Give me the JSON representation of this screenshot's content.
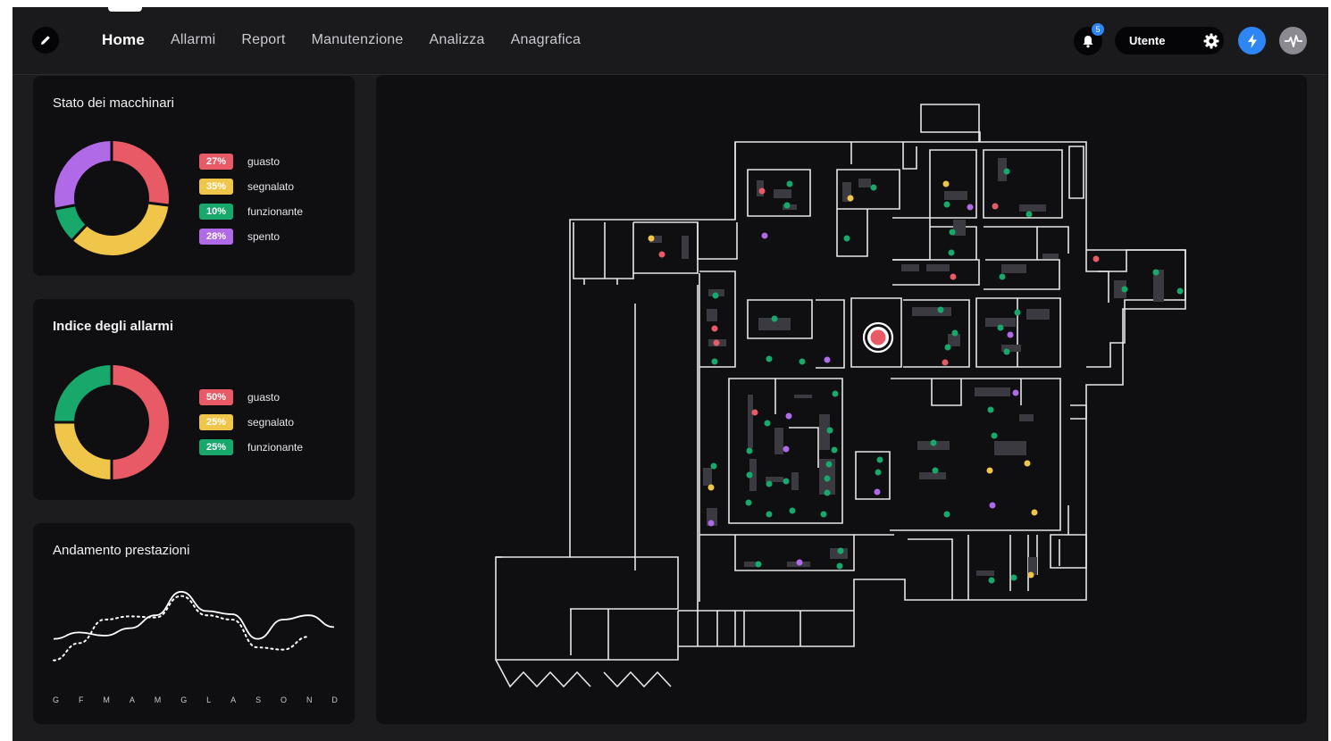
{
  "nav": {
    "items": [
      {
        "label": "Home",
        "active": true
      },
      {
        "label": "Allarmi"
      },
      {
        "label": "Report"
      },
      {
        "label": "Manutenzione"
      },
      {
        "label": "Analizza"
      },
      {
        "label": "Anagrafica"
      }
    ]
  },
  "header": {
    "notifications_count": "5",
    "user_label": "Utente",
    "icons": [
      "edit-icon",
      "bell-icon",
      "gear-icon",
      "bolt-icon",
      "pulse-icon"
    ]
  },
  "colors": {
    "red": "#e85a66",
    "yellow": "#f0c64a",
    "green": "#18a86c",
    "purple": "#b06ae8",
    "accent": "#2e86f5"
  },
  "stato": {
    "title": "Stato dei macchinari",
    "items": [
      {
        "pct": "27%",
        "label": "guasto",
        "value": 27,
        "color": "#e85a66"
      },
      {
        "pct": "35%",
        "label": "segnalato",
        "value": 35,
        "color": "#f0c64a"
      },
      {
        "pct": "10%",
        "label": "funzionante",
        "value": 10,
        "color": "#18a86c"
      },
      {
        "pct": "28%",
        "label": "spento",
        "value": 28,
        "color": "#b06ae8"
      }
    ]
  },
  "allarmi": {
    "title": "Indice degli allarmi",
    "items": [
      {
        "pct": "50%",
        "label": "guasto",
        "value": 50,
        "color": "#e85a66"
      },
      {
        "pct": "25%",
        "label": "segnalato",
        "value": 25,
        "color": "#f0c64a"
      },
      {
        "pct": "25%",
        "label": "funzionante",
        "value": 25,
        "color": "#18a86c"
      }
    ]
  },
  "prestazioni": {
    "title": "Andamento prestazioni",
    "months": [
      "G",
      "F",
      "M",
      "A",
      "M",
      "G",
      "L",
      "A",
      "S",
      "O",
      "N",
      "D"
    ]
  },
  "chart_data": {
    "type": "line",
    "x": [
      "G",
      "F",
      "M",
      "A",
      "M",
      "G",
      "L",
      "A",
      "S",
      "O",
      "N",
      "D"
    ],
    "series": [
      {
        "style": "solid",
        "values": [
          42,
          48,
          45,
          52,
          64,
          86,
          68,
          65,
          42,
          60,
          64,
          53
        ]
      },
      {
        "style": "dotted",
        "values": [
          22,
          38,
          60,
          63,
          62,
          82,
          64,
          60,
          34,
          32,
          44
        ]
      }
    ],
    "ylim": [
      0,
      100
    ],
    "grid": false
  }
}
